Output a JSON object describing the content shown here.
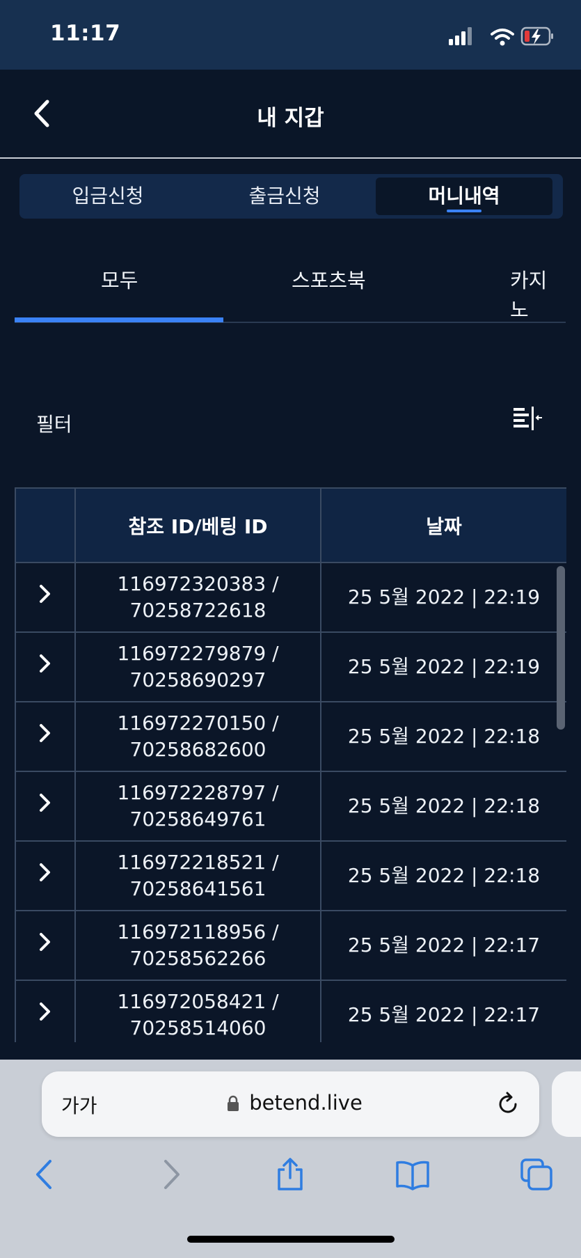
{
  "status_bar": {
    "time": "11:17"
  },
  "header": {
    "title": "내 지갑"
  },
  "wallet_tabs": [
    {
      "label": "입금신청",
      "active": false
    },
    {
      "label": "출금신청",
      "active": false
    },
    {
      "label": "머니내역",
      "active": true
    }
  ],
  "sub_tabs": [
    {
      "label": "모두",
      "active": true
    },
    {
      "label": "스포츠북",
      "active": false
    },
    {
      "label": "카지노",
      "active": false
    }
  ],
  "filter": {
    "label": "필터"
  },
  "table": {
    "headers": [
      "",
      "참조 ID/베팅 ID",
      "날짜"
    ],
    "rows": [
      {
        "id_line1": "116972320383 /",
        "id_line2": "70258722618",
        "date": "25 5월 2022 | 22:19"
      },
      {
        "id_line1": "116972279879 /",
        "id_line2": "70258690297",
        "date": "25 5월 2022 | 22:19"
      },
      {
        "id_line1": "116972270150 /",
        "id_line2": "70258682600",
        "date": "25 5월 2022 | 22:18"
      },
      {
        "id_line1": "116972228797 /",
        "id_line2": "70258649761",
        "date": "25 5월 2022 | 22:18"
      },
      {
        "id_line1": "116972218521 /",
        "id_line2": "70258641561",
        "date": "25 5월 2022 | 22:18"
      },
      {
        "id_line1": "116972118956 /",
        "id_line2": "70258562266",
        "date": "25 5월 2022 | 22:17"
      },
      {
        "id_line1": "116972058421 /",
        "id_line2": "70258514060",
        "date": "25 5월 2022 | 22:17"
      }
    ]
  },
  "browser": {
    "aa_label": "가가",
    "url": "betend.live"
  },
  "colors": {
    "background": "#0b1628",
    "accent": "#3b82f6",
    "header_bg": "#102544"
  }
}
